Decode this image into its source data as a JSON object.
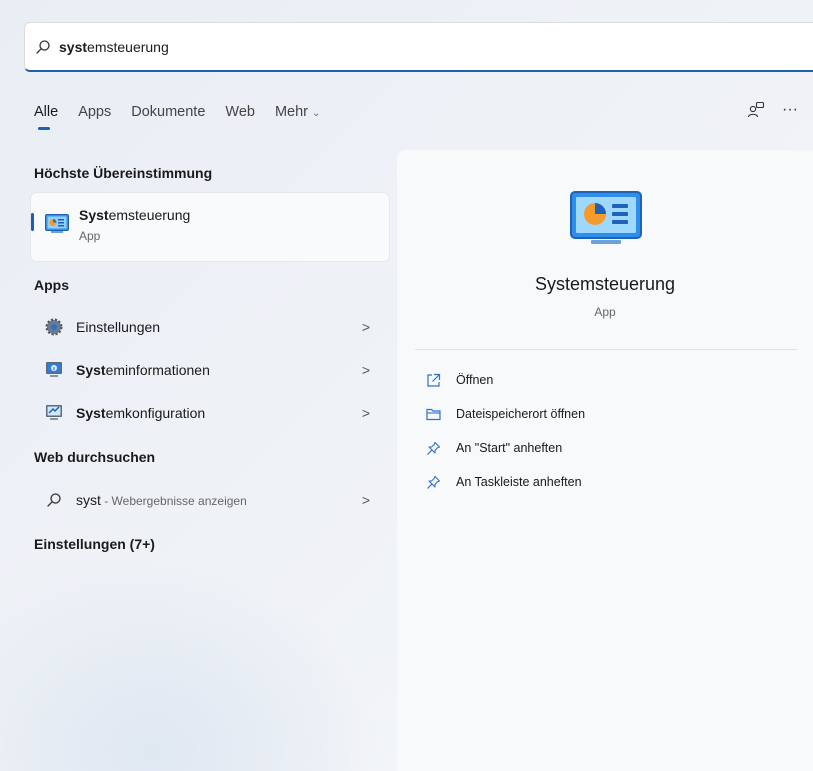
{
  "search": {
    "query_bold": "syst",
    "query_rest": "emsteuerung"
  },
  "tabs": [
    {
      "label": "Alle",
      "active": true
    },
    {
      "label": "Apps"
    },
    {
      "label": "Dokumente"
    },
    {
      "label": "Web"
    },
    {
      "label": "Mehr"
    }
  ],
  "top_right": {
    "icons": [
      "account-switch-icon",
      "more-options-icon"
    ],
    "more": "···"
  },
  "best_match": {
    "heading": "Höchste Übereinstimmung",
    "name_bold": "Syst",
    "name_rest": "emsteuerung",
    "sub": "App"
  },
  "apps": {
    "heading": "Apps",
    "items": [
      {
        "bold": "",
        "rest": "Einstellungen",
        "icon": "settings-gear-icon"
      },
      {
        "bold": "Syst",
        "rest": "eminformationen",
        "icon": "system-information-icon"
      },
      {
        "bold": "Syst",
        "rest": "emkonfiguration",
        "icon": "system-configuration-icon"
      }
    ]
  },
  "web": {
    "heading": "Web durchsuchen",
    "query": "syst",
    "suffix": " - Webergebnisse anzeigen"
  },
  "settings": {
    "heading": "Einstellungen (7+)"
  },
  "arrow": ">",
  "preview": {
    "title": "Systemsteuerung",
    "sub": "App",
    "actions": [
      {
        "label": "Öffnen",
        "icon": "open-icon"
      },
      {
        "label": "Dateispeicherort öffnen",
        "icon": "folder-icon"
      },
      {
        "label": "An \"Start\" anheften",
        "icon": "pin-icon"
      },
      {
        "label": "An Taskleiste anheften",
        "icon": "pin-icon"
      }
    ]
  },
  "colors": {
    "accent": "#1f5fb0"
  }
}
